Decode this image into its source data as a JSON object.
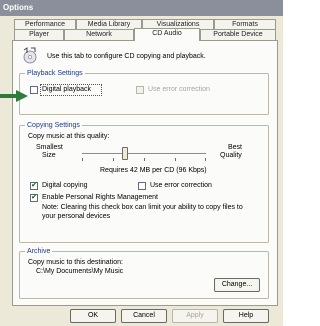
{
  "window": {
    "title": "Options"
  },
  "tabs_back": [
    "Performance",
    "Media Library",
    "Visualizations",
    "Formats"
  ],
  "tabs_front": [
    "Player",
    "Network",
    "CD Audio",
    "Portable Device"
  ],
  "intro_text": "Use this tab to configure CD copying and playback.",
  "playback": {
    "group_title": "Playback Settings",
    "digital_playback": "Digital playback",
    "use_error_correction": "Use error correction"
  },
  "copying": {
    "group_title": "Copying Settings",
    "copy_music_quality": "Copy music at this quality:",
    "smallest": "Smallest",
    "size": "Size",
    "best": "Best",
    "quality": "Quality",
    "requires": "Requires 42 MB per CD (96 Kbps)",
    "digital_copying": "Digital copying",
    "use_error_correction": "Use error correction",
    "enable_prm": "Enable Personal Rights Management",
    "note_line1": "Note: Clearing this check box can limit your ability to copy files to",
    "note_line2": "your personal devices",
    "digital_copying_checked": true,
    "enable_prm_checked": true,
    "digital_playback_checked": false,
    "quality_level_fraction": 0.35,
    "check_mark": "✔"
  },
  "archive": {
    "group_title": "Archive",
    "copy_to_dest": "Copy music to this destination:",
    "path": "C:\\My Documents\\My Music",
    "change_button": "Change..."
  },
  "buttons": {
    "ok": "OK",
    "cancel": "Cancel",
    "apply": "Apply",
    "help": "Help"
  },
  "colors": {
    "arrow": "#2f7a3c",
    "title_bar": "#8a8f9c"
  }
}
